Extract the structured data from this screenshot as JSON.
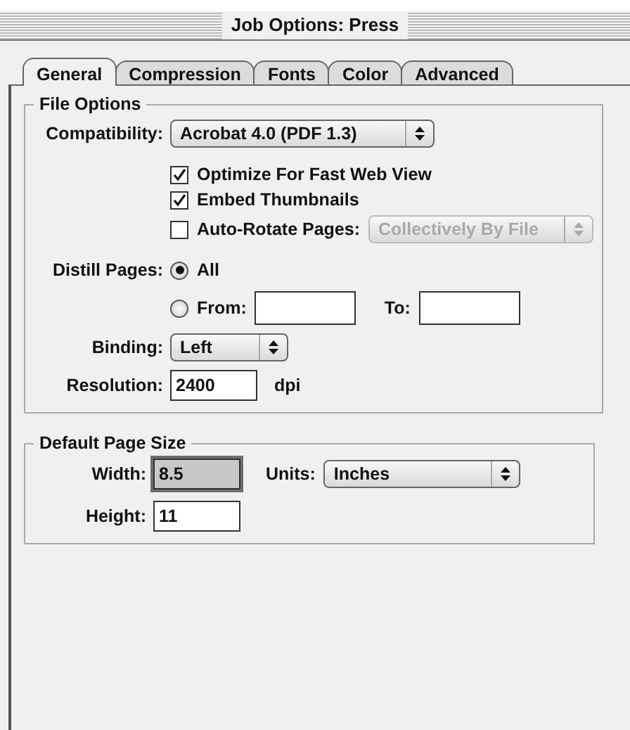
{
  "window": {
    "title": "Job Options: Press"
  },
  "tabs": [
    {
      "label": "General",
      "selected": true
    },
    {
      "label": "Compression",
      "selected": false
    },
    {
      "label": "Fonts",
      "selected": false
    },
    {
      "label": "Color",
      "selected": false
    },
    {
      "label": "Advanced",
      "selected": false
    }
  ],
  "file_options": {
    "title": "File Options",
    "compatibility": {
      "label": "Compatibility:",
      "value": "Acrobat 4.0 (PDF 1.3)"
    },
    "checkboxes": [
      {
        "label": "Optimize For Fast Web View",
        "checked": true
      },
      {
        "label": "Embed Thumbnails",
        "checked": true
      },
      {
        "label": "Auto-Rotate Pages:",
        "checked": false,
        "popup": {
          "value": "Collectively By File",
          "disabled": true
        }
      }
    ],
    "distill": {
      "label": "Distill Pages:",
      "options": [
        {
          "label": "All",
          "selected": true
        },
        {
          "label": "From:",
          "selected": false
        }
      ],
      "to_label": "To:"
    },
    "binding": {
      "label": "Binding:",
      "value": "Left"
    },
    "resolution": {
      "label": "Resolution:",
      "value": "2400",
      "unit": "dpi"
    }
  },
  "page_size": {
    "title": "Default Page Size",
    "width": {
      "label": "Width:",
      "value": "8.5",
      "focused": true
    },
    "units": {
      "label": "Units:",
      "value": "Inches"
    },
    "height": {
      "label": "Height:",
      "value": "11",
      "focused": false
    }
  }
}
